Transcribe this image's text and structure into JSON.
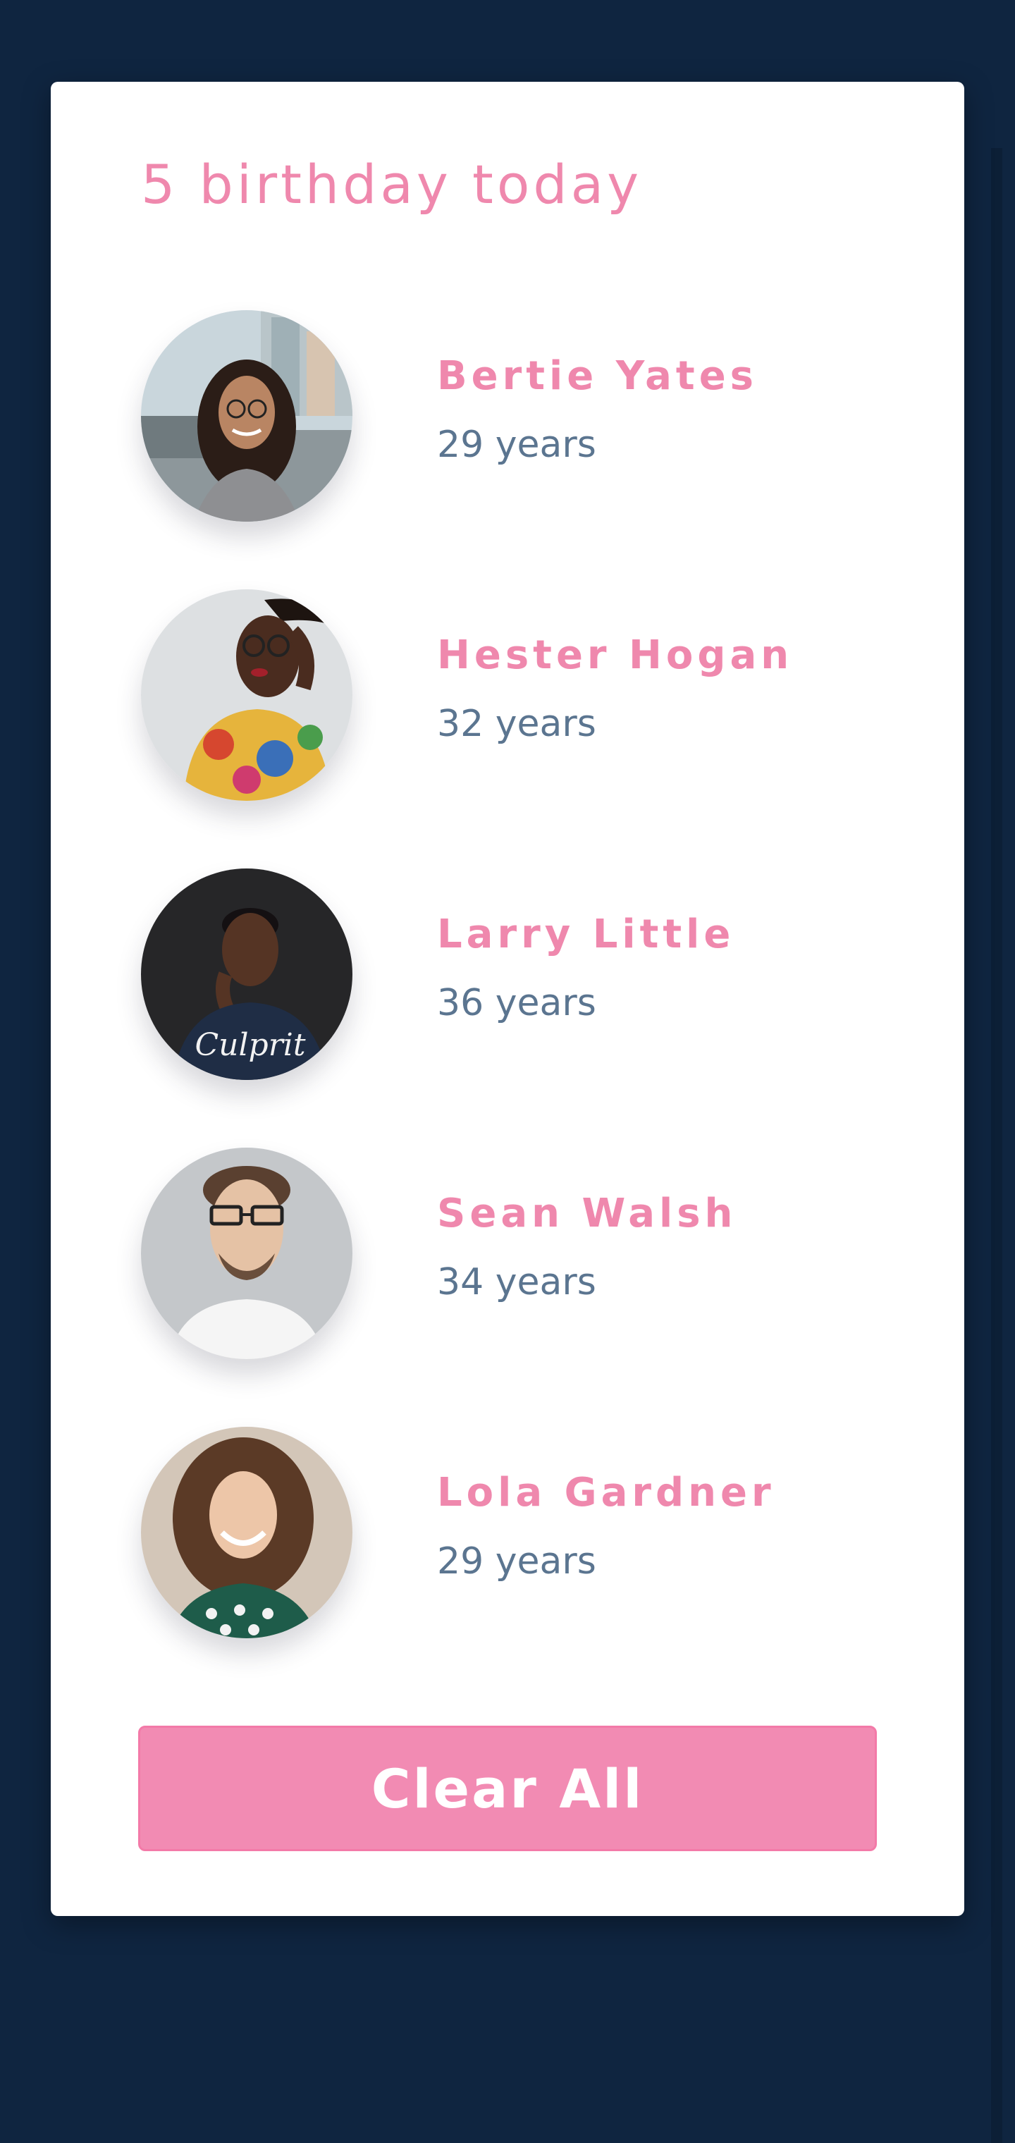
{
  "header": {
    "title": "5 birthday today"
  },
  "people": [
    {
      "name": "Bertie Yates",
      "age": "29 years"
    },
    {
      "name": "Hester Hogan",
      "age": "32 years"
    },
    {
      "name": "Larry Little",
      "age": "36 years"
    },
    {
      "name": "Sean Walsh",
      "age": "34 years"
    },
    {
      "name": "Lola Gardner",
      "age": "29 years"
    }
  ],
  "actions": {
    "clear_label": "Clear All"
  },
  "colors": {
    "background": "#0f2540",
    "card": "#ffffff",
    "accent_pink": "#ef88ad",
    "button_pink": "#f28bb3",
    "age_text": "#5b7590"
  }
}
